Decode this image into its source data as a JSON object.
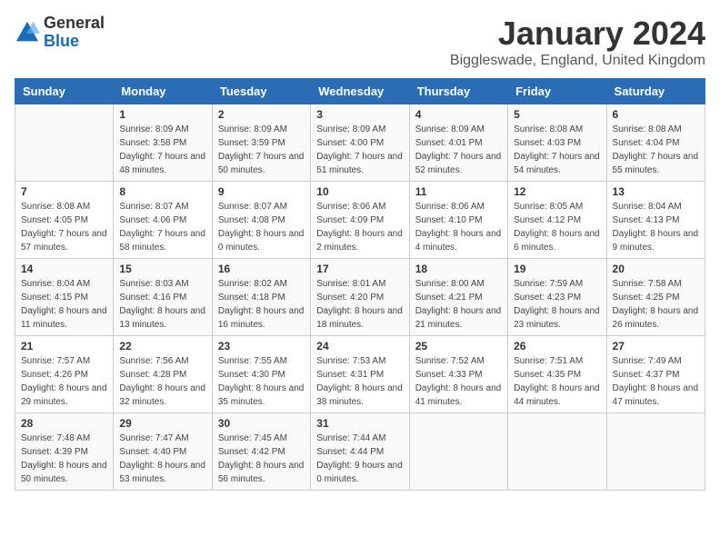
{
  "logo": {
    "general": "General",
    "blue": "Blue"
  },
  "title": "January 2024",
  "location": "Biggleswade, England, United Kingdom",
  "weekdays": [
    "Sunday",
    "Monday",
    "Tuesday",
    "Wednesday",
    "Thursday",
    "Friday",
    "Saturday"
  ],
  "weeks": [
    [
      {
        "day": "",
        "sunrise": "",
        "sunset": "",
        "daylight": ""
      },
      {
        "day": "1",
        "sunrise": "8:09 AM",
        "sunset": "3:58 PM",
        "daylight": "7 hours and 48 minutes."
      },
      {
        "day": "2",
        "sunrise": "8:09 AM",
        "sunset": "3:59 PM",
        "daylight": "7 hours and 50 minutes."
      },
      {
        "day": "3",
        "sunrise": "8:09 AM",
        "sunset": "4:00 PM",
        "daylight": "7 hours and 51 minutes."
      },
      {
        "day": "4",
        "sunrise": "8:09 AM",
        "sunset": "4:01 PM",
        "daylight": "7 hours and 52 minutes."
      },
      {
        "day": "5",
        "sunrise": "8:08 AM",
        "sunset": "4:03 PM",
        "daylight": "7 hours and 54 minutes."
      },
      {
        "day": "6",
        "sunrise": "8:08 AM",
        "sunset": "4:04 PM",
        "daylight": "7 hours and 55 minutes."
      }
    ],
    [
      {
        "day": "7",
        "sunrise": "8:08 AM",
        "sunset": "4:05 PM",
        "daylight": "7 hours and 57 minutes."
      },
      {
        "day": "8",
        "sunrise": "8:07 AM",
        "sunset": "4:06 PM",
        "daylight": "7 hours and 58 minutes."
      },
      {
        "day": "9",
        "sunrise": "8:07 AM",
        "sunset": "4:08 PM",
        "daylight": "8 hours and 0 minutes."
      },
      {
        "day": "10",
        "sunrise": "8:06 AM",
        "sunset": "4:09 PM",
        "daylight": "8 hours and 2 minutes."
      },
      {
        "day": "11",
        "sunrise": "8:06 AM",
        "sunset": "4:10 PM",
        "daylight": "8 hours and 4 minutes."
      },
      {
        "day": "12",
        "sunrise": "8:05 AM",
        "sunset": "4:12 PM",
        "daylight": "8 hours and 6 minutes."
      },
      {
        "day": "13",
        "sunrise": "8:04 AM",
        "sunset": "4:13 PM",
        "daylight": "8 hours and 9 minutes."
      }
    ],
    [
      {
        "day": "14",
        "sunrise": "8:04 AM",
        "sunset": "4:15 PM",
        "daylight": "8 hours and 11 minutes."
      },
      {
        "day": "15",
        "sunrise": "8:03 AM",
        "sunset": "4:16 PM",
        "daylight": "8 hours and 13 minutes."
      },
      {
        "day": "16",
        "sunrise": "8:02 AM",
        "sunset": "4:18 PM",
        "daylight": "8 hours and 16 minutes."
      },
      {
        "day": "17",
        "sunrise": "8:01 AM",
        "sunset": "4:20 PM",
        "daylight": "8 hours and 18 minutes."
      },
      {
        "day": "18",
        "sunrise": "8:00 AM",
        "sunset": "4:21 PM",
        "daylight": "8 hours and 21 minutes."
      },
      {
        "day": "19",
        "sunrise": "7:59 AM",
        "sunset": "4:23 PM",
        "daylight": "8 hours and 23 minutes."
      },
      {
        "day": "20",
        "sunrise": "7:58 AM",
        "sunset": "4:25 PM",
        "daylight": "8 hours and 26 minutes."
      }
    ],
    [
      {
        "day": "21",
        "sunrise": "7:57 AM",
        "sunset": "4:26 PM",
        "daylight": "8 hours and 29 minutes."
      },
      {
        "day": "22",
        "sunrise": "7:56 AM",
        "sunset": "4:28 PM",
        "daylight": "8 hours and 32 minutes."
      },
      {
        "day": "23",
        "sunrise": "7:55 AM",
        "sunset": "4:30 PM",
        "daylight": "8 hours and 35 minutes."
      },
      {
        "day": "24",
        "sunrise": "7:53 AM",
        "sunset": "4:31 PM",
        "daylight": "8 hours and 38 minutes."
      },
      {
        "day": "25",
        "sunrise": "7:52 AM",
        "sunset": "4:33 PM",
        "daylight": "8 hours and 41 minutes."
      },
      {
        "day": "26",
        "sunrise": "7:51 AM",
        "sunset": "4:35 PM",
        "daylight": "8 hours and 44 minutes."
      },
      {
        "day": "27",
        "sunrise": "7:49 AM",
        "sunset": "4:37 PM",
        "daylight": "8 hours and 47 minutes."
      }
    ],
    [
      {
        "day": "28",
        "sunrise": "7:48 AM",
        "sunset": "4:39 PM",
        "daylight": "8 hours and 50 minutes."
      },
      {
        "day": "29",
        "sunrise": "7:47 AM",
        "sunset": "4:40 PM",
        "daylight": "8 hours and 53 minutes."
      },
      {
        "day": "30",
        "sunrise": "7:45 AM",
        "sunset": "4:42 PM",
        "daylight": "8 hours and 56 minutes."
      },
      {
        "day": "31",
        "sunrise": "7:44 AM",
        "sunset": "4:44 PM",
        "daylight": "9 hours and 0 minutes."
      },
      {
        "day": "",
        "sunrise": "",
        "sunset": "",
        "daylight": ""
      },
      {
        "day": "",
        "sunrise": "",
        "sunset": "",
        "daylight": ""
      },
      {
        "day": "",
        "sunrise": "",
        "sunset": "",
        "daylight": ""
      }
    ]
  ]
}
